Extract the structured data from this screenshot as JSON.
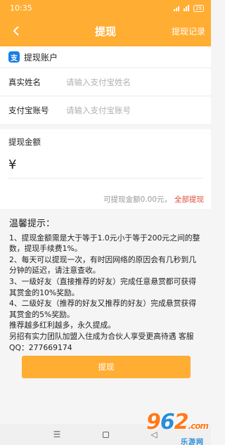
{
  "status": {
    "time": "10:35",
    "battery": "29"
  },
  "appbar": {
    "title": "提现",
    "record_label": "提现记录"
  },
  "account": {
    "icon_text": "支",
    "heading": "提现账户",
    "name_label": "真实姓名",
    "name_placeholder": "请输入支付宝姓名",
    "account_label": "支付宝账号",
    "account_placeholder": "请输入支付宝账号"
  },
  "amount": {
    "label": "提现金额",
    "currency": "¥",
    "available": "可提现金额0.00元，",
    "withdraw_all": "全部提现"
  },
  "tips": {
    "title": "温馨提示：",
    "lines": [
      "1、提现金额需是大于等于1.0元小于等于200元之间的整数，提现手续费1%。",
      "2、每天可以提现一次，有时因网络的原因会有几秒到几分钟的延迟，请注意查收。",
      "3、一级好友（直接推荐的好友）完成任意悬赏都可获得其赏金的10%奖励。",
      "4、二级好友（推荐的好友又推荐的好友）完成悬赏获得其赏金的5%奖励。",
      "推荐越多红利越多，永久提成。",
      "另招有实力团队加盟入住成为合伙人享受更高待遇 客服QQ：277669174"
    ]
  },
  "submit_label": "提现",
  "navbar": {
    "menu": "☰",
    "back": "◁"
  },
  "watermark": {
    "num_a": "9",
    "num_b": "6",
    "num_c": "2",
    "suffix": ".com",
    "sub": "乐游网"
  },
  "colors": {
    "brand": "#ffad33",
    "danger": "#e04b3a",
    "alipay": "#1a7fe0"
  }
}
